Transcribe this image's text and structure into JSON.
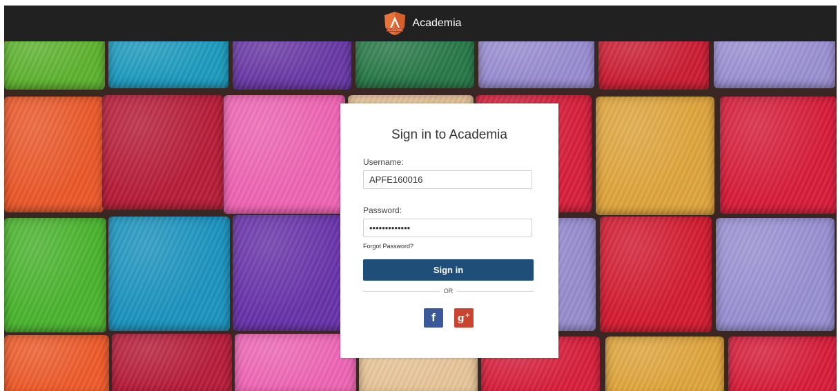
{
  "header": {
    "app_name": "Academia",
    "logo_text": "ACADEMIA"
  },
  "login": {
    "title": "Sign in to Academia",
    "username_label": "Username:",
    "username_value": "APFE160016",
    "password_label": "Password:",
    "password_value": "•••••••••••••",
    "forgot_label": "Forgot Password?",
    "signin_label": "Sign in",
    "or_label": "OR"
  },
  "social": {
    "facebook_icon_text": "f",
    "google_icon_text": "g",
    "google_icon_sup": "+"
  },
  "colors": {
    "topbar": "#212121",
    "signin_button": "#1f4e79",
    "facebook": "#3b5998",
    "google_plus": "#c9452f"
  }
}
